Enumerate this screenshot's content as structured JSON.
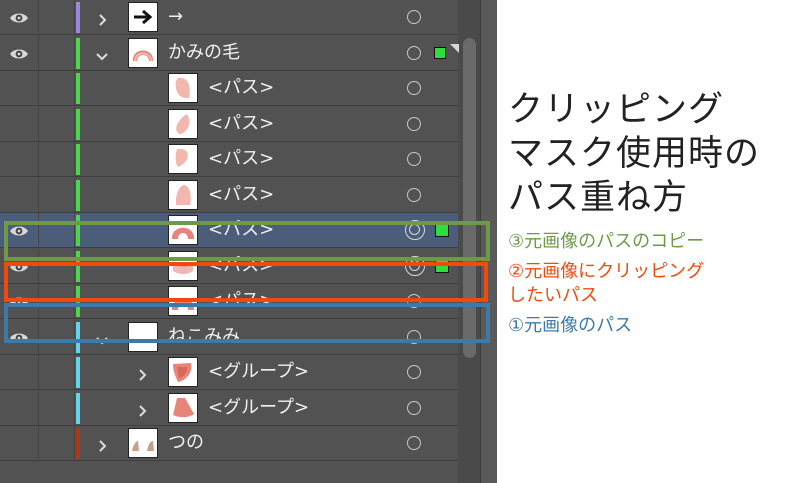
{
  "layers": [
    {
      "name": "→",
      "level": 0,
      "visible": true,
      "bar": "#9b87e0",
      "chevron": "right",
      "thumb": "arrow-thumb",
      "target": "single",
      "selected": false,
      "square": ""
    },
    {
      "name": "かみの毛",
      "level": 0,
      "visible": true,
      "bar": "#4cd64c",
      "chevron": "down",
      "thumb": "hair-thumb",
      "target": "single",
      "selected": false,
      "square": "small"
    },
    {
      "name": "<パス>",
      "level": 1,
      "visible": false,
      "bar": "#4cd64c",
      "chevron": "",
      "thumb": "path-thumb-1",
      "target": "single",
      "selected": false,
      "square": ""
    },
    {
      "name": "<パス>",
      "level": 1,
      "visible": false,
      "bar": "#4cd64c",
      "chevron": "",
      "thumb": "path-thumb-2",
      "target": "single",
      "selected": false,
      "square": ""
    },
    {
      "name": "<パス>",
      "level": 1,
      "visible": false,
      "bar": "#4cd64c",
      "chevron": "",
      "thumb": "path-thumb-3",
      "target": "single",
      "selected": false,
      "square": ""
    },
    {
      "name": "<パス>",
      "level": 1,
      "visible": false,
      "bar": "#4cd64c",
      "chevron": "",
      "thumb": "path-thumb-4",
      "target": "single",
      "selected": false,
      "square": ""
    },
    {
      "name": "<パス>",
      "level": 1,
      "visible": true,
      "bar": "#4cd64c",
      "chevron": "",
      "thumb": "arch-thumb",
      "target": "double",
      "selected": true,
      "square": "big"
    },
    {
      "name": "<パス>",
      "level": 1,
      "visible": true,
      "bar": "#4cd64c",
      "chevron": "",
      "thumb": "band-thumb",
      "target": "double",
      "selected": false,
      "square": "big"
    },
    {
      "name": "<パス>",
      "level": 1,
      "visible": true,
      "bar": "#4cd64c",
      "chevron": "",
      "thumb": "arch-thumb",
      "target": "single",
      "selected": false,
      "square": ""
    },
    {
      "name": "ねこみみ",
      "level": 0,
      "visible": true,
      "bar": "#5fd6ee",
      "chevron": "down",
      "thumb": "blank-thumb",
      "target": "single",
      "selected": false,
      "square": ""
    },
    {
      "name": "<グループ>",
      "level": 1,
      "visible": false,
      "bar": "#5fd6ee",
      "chevron": "right",
      "thumb": "ear-thumb-1",
      "target": "single",
      "selected": false,
      "square": ""
    },
    {
      "name": "<グループ>",
      "level": 1,
      "visible": false,
      "bar": "#5fd6ee",
      "chevron": "right",
      "thumb": "ear-thumb-2",
      "target": "single",
      "selected": false,
      "square": ""
    },
    {
      "name": "つの",
      "level": 0,
      "visible": false,
      "bar": "#a8391a",
      "chevron": "right",
      "thumb": "horn-thumb",
      "target": "single",
      "selected": false,
      "square": ""
    }
  ],
  "title_lines": [
    "クリッピング",
    "マスク使用時の",
    "パス重ね方"
  ],
  "notes": {
    "green": "③元画像のパスのコピー",
    "orange_1": "②元画像にクリッピング",
    "orange_2": "したいパス",
    "blue": "①元画像のパス"
  },
  "colors": {
    "panel_bg": "#525252",
    "selected_row": "#4b5d78",
    "highlight_green": "#6e9a48",
    "highlight_orange": "#f04a10",
    "highlight_blue": "#3e7aa8",
    "selection_square": "#2fdd3c",
    "shape_fill": "#e8857a",
    "shape_light": "#f2b7ae"
  }
}
